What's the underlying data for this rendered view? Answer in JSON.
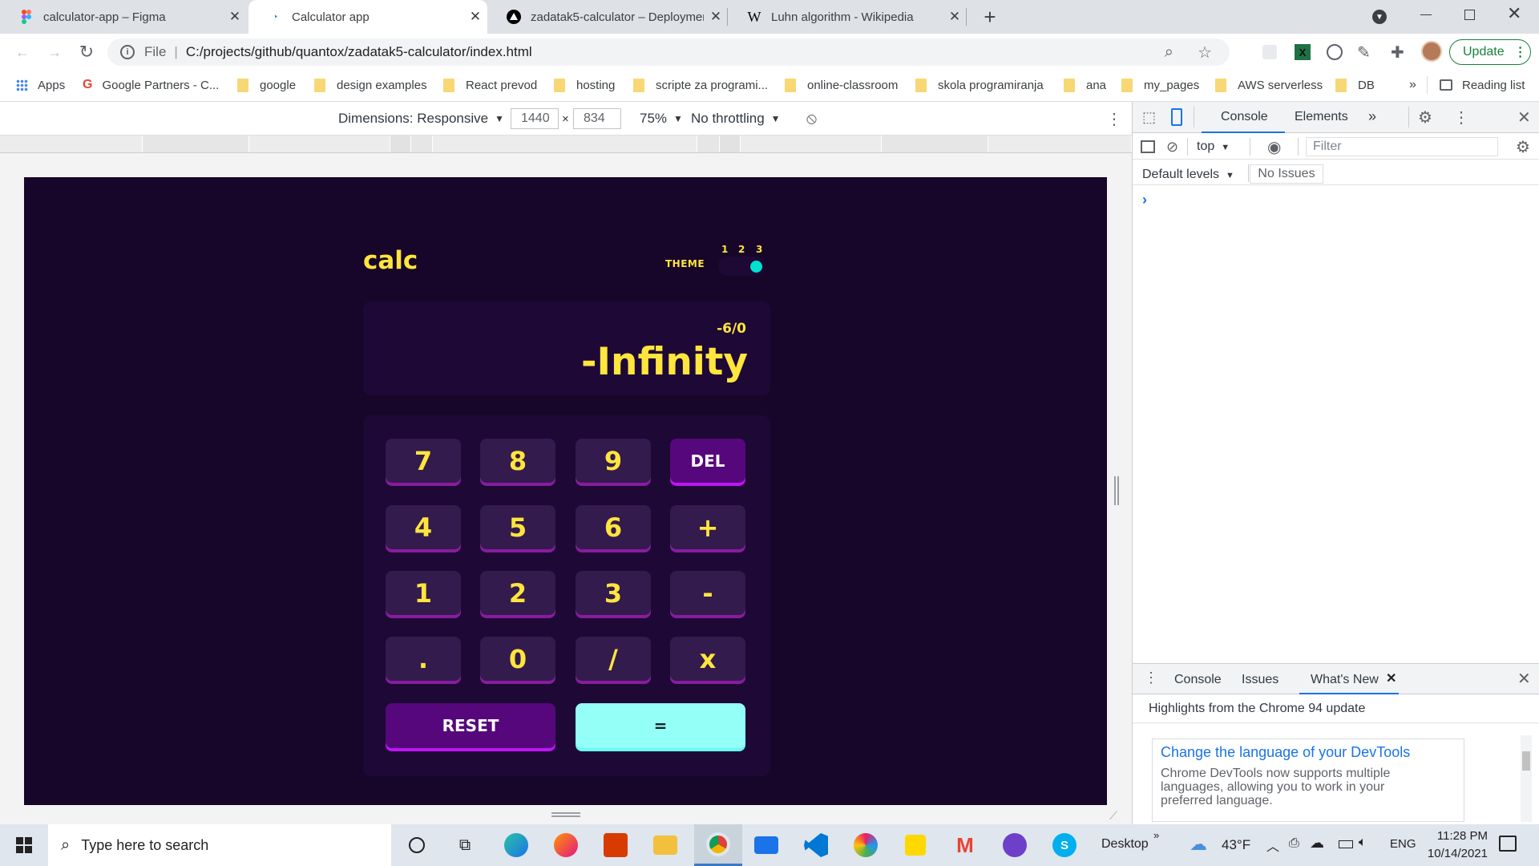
{
  "browser": {
    "tabs": [
      {
        "title": "calculator-app – Figma",
        "icon": "figma-icon",
        "active": false
      },
      {
        "title": "Calculator app",
        "icon": "page-icon",
        "active": true
      },
      {
        "title": "zadatak5-calculator – Deploymen",
        "icon": "vercel-icon",
        "active": false
      },
      {
        "title": "Luhn algorithm - Wikipedia",
        "icon": "wikipedia-icon",
        "active": false
      }
    ],
    "new_tab": "+",
    "url_scheme": "File",
    "url": "C:/projects/github/quantox/zadatak5-calculator/index.html",
    "update_label": "Update",
    "bookmarks": [
      "Apps",
      "Google Partners - C...",
      "google",
      "design examples",
      "React prevod",
      "hosting",
      "scripte za programi...",
      "online-classroom",
      "skola programiranja",
      "ana",
      "my_pages",
      "AWS serverless",
      "DB"
    ],
    "bookmarks_more": "»",
    "reading_list": "Reading list"
  },
  "device_toolbar": {
    "dimensions_label": "Dimensions: Responsive",
    "width": "1440",
    "times": "×",
    "height": "834",
    "zoom": "75%",
    "throttling": "No throttling"
  },
  "calculator": {
    "logo": "calc",
    "theme_label": "THEME",
    "theme_numbers": [
      "1",
      "2",
      "3"
    ],
    "theme_selected": 3,
    "expression": "-6/0",
    "result": "-Infinity",
    "keys": [
      "7",
      "8",
      "9",
      "DEL",
      "4",
      "5",
      "6",
      "+",
      "1",
      "2",
      "3",
      "-",
      ".",
      "0",
      "/",
      "x"
    ],
    "reset": "RESET",
    "equals": "=",
    "colors": {
      "background": "#17062a",
      "screen": "#1e0836",
      "key": "#331b4d",
      "text": "#ffe53d",
      "accent": "#56077c",
      "equals": "#93fff7",
      "toggle": "#00e0d1"
    }
  },
  "devtools": {
    "tabs": [
      "Console",
      "Elements"
    ],
    "active_tab": "Console",
    "more": "»",
    "context": "top",
    "filter_placeholder": "Filter",
    "levels": "Default levels",
    "issues": "No Issues",
    "prompt": "›",
    "drawer_tabs": [
      "Console",
      "Issues",
      "What's New"
    ],
    "drawer_active": "What's New",
    "highlights": "Highlights from the Chrome 94 update",
    "card_title": "Change the language of your DevTools",
    "card_body": [
      "Chrome DevTools now supports multiple",
      "languages, allowing you to work in your",
      "preferred language."
    ]
  },
  "taskbar": {
    "search_placeholder": "Type here to search",
    "desktop": "Desktop",
    "chevron": "»",
    "temperature": "43°F",
    "language": "ENG",
    "time": "11:28 PM",
    "date": "10/14/2021"
  }
}
